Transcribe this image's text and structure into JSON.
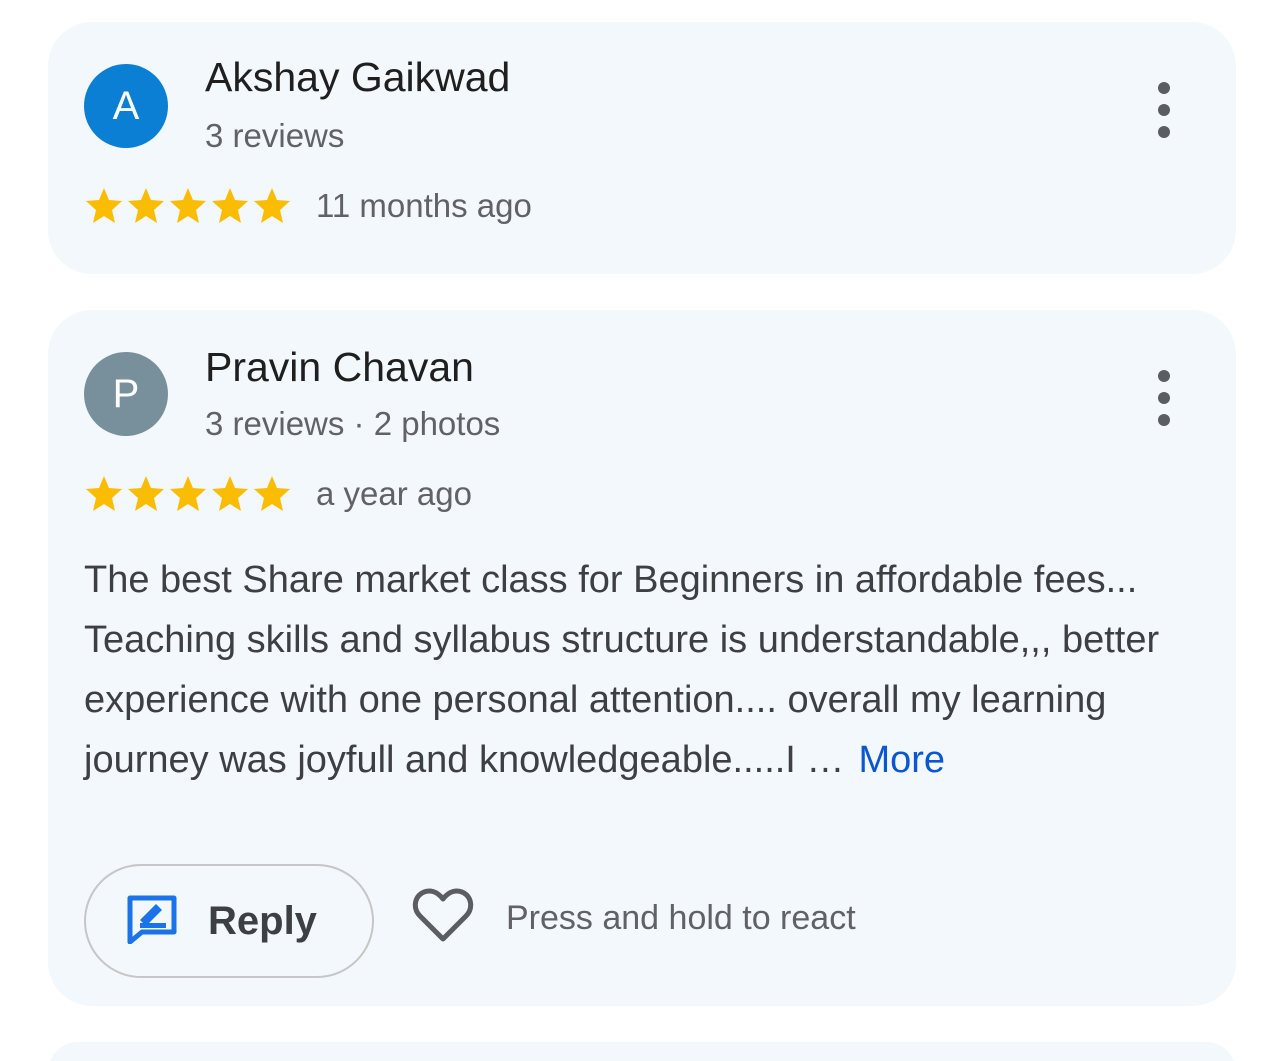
{
  "reviews": [
    {
      "avatar_letter": "A",
      "avatar_color": "#0b7fd4",
      "name": "Akshay Gaikwad",
      "meta": "3 reviews",
      "rating": 5,
      "rating_max": 5,
      "date": "11 months ago"
    },
    {
      "avatar_letter": "P",
      "avatar_color": "#78909c",
      "name": "Pravin Chavan",
      "meta": "3 reviews · 2 photos",
      "rating": 5,
      "rating_max": 5,
      "date": "a year ago",
      "text": "The best Share market class for Beginners in affordable fees... Teaching skills and syllabus structure is understandable,,, better experience with one personal attention.... overall my learning journey was joyfull and knowledgeable.....I …",
      "more_label": "More",
      "reply_label": "Reply",
      "react_label": "Press and hold to react"
    }
  ],
  "colors": {
    "card_background": "#f2f8fc",
    "star": "#fbbc04",
    "link": "#0b57d0",
    "reply_icon": "#1a73e8"
  },
  "icons": {
    "more_menu": "more-vert-icon",
    "star": "star-icon",
    "reply": "reply-icon",
    "react": "heart-icon"
  }
}
